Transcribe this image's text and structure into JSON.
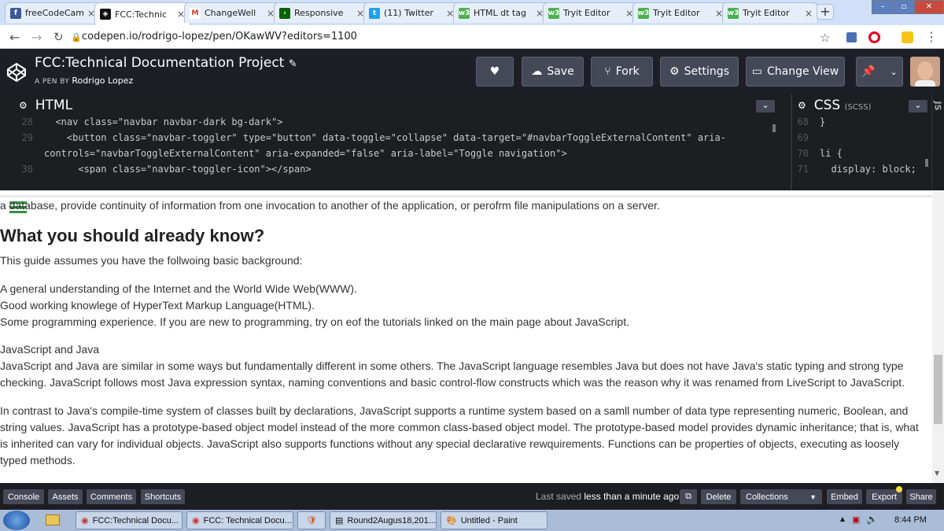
{
  "browser": {
    "tabs": [
      {
        "label": "freeCodeCam",
        "icon": "facebook-icon",
        "color": "#3b5998",
        "glyph": "f"
      },
      {
        "label": "FCC:Technic",
        "icon": "codepen-icon",
        "color": "#111111",
        "glyph": "◈"
      },
      {
        "label": "ChangeWell",
        "icon": "gmail-icon",
        "color": "#ffffff",
        "glyph": "M"
      },
      {
        "label": "Responsive",
        "icon": "freecodecamp-icon",
        "color": "#006400",
        "glyph": "›"
      },
      {
        "label": "(11) Twitter",
        "icon": "twitter-icon",
        "color": "#1da1f2",
        "glyph": "t"
      },
      {
        "label": "HTML dt tag",
        "icon": "w3schools-icon",
        "color": "#4caf50",
        "glyph": "w3"
      },
      {
        "label": "Tryit Editor",
        "icon": "w3schools-icon",
        "color": "#4caf50",
        "glyph": "w3"
      },
      {
        "label": "Tryit Editor",
        "icon": "w3schools-icon",
        "color": "#4caf50",
        "glyph": "w3"
      },
      {
        "label": "Tryit Editor",
        "icon": "w3schools-icon",
        "color": "#4caf50",
        "glyph": "w3"
      }
    ],
    "url": "codepen.io/rodrigo-lopez/pen/OKawWV?editors=1100"
  },
  "pen": {
    "title": "FCC:Technical Documentation Project",
    "author_prefix": "A PEN BY",
    "author": "Rodrigo Lopez",
    "buttons": {
      "save": "Save",
      "fork": "Fork",
      "settings": "Settings",
      "change_view": "Change View"
    }
  },
  "html_panel": {
    "title": "HTML",
    "lines": [
      {
        "n": "28",
        "code": "  <nav class=\"navbar navbar-dark bg-dark\">"
      },
      {
        "n": "29",
        "code": "    <button class=\"navbar-toggler\" type=\"button\" data-toggle=\"collapse\" data-target=\"#navbarToggleExternalContent\" aria-"
      },
      {
        "n": "",
        "code": "controls=\"navbarToggleExternalContent\" aria-expanded=\"false\" aria-label=\"Toggle navigation\">"
      },
      {
        "n": "30",
        "code": "      <span class=\"navbar-toggler-icon\"></span>"
      }
    ]
  },
  "css_panel": {
    "title": "CSS",
    "sub": "(SCSS)",
    "lines": [
      {
        "n": "68",
        "code": "}"
      },
      {
        "n": "69",
        "code": ""
      },
      {
        "n": "70",
        "code": "li {"
      },
      {
        "n": "71",
        "code": "  display: block;"
      }
    ]
  },
  "js_tab": "JS",
  "content": {
    "intro": "a database, provide continuity of information from one invocation to another of the application, or perofrm file manipulations on a server.",
    "heading": "What you should already know?",
    "p1": "This guide assumes you have the follwoing basic background:",
    "list": [
      "A general understanding of the Internet and the World Wide Web(WWW).",
      "Good working knowlege of HyperText Markup Language(HTML).",
      "Some programming experience. If you are new to programming, try on eof the tutorials linked on the main page about JavaScript."
    ],
    "subtitle": "JavaScript and Java",
    "p2": "JavaScript and Java are similar in some ways but fundamentally different in some others. The JavaScript language resembles Java but does not have Java's static typing and strong type checking. JavaScript follows most Java expression syntax, naming conventions and basic control-flow constructs which was the reason why it was renamed from LiveScript to JavaScript.",
    "p3": "In contrast to Java's compile-time system of classes built by declarations, JavaScript supports a runtime system based on a samll number of data type representing numeric, Boolean, and string values. JavaScript has a prototype-based object model instead of the more common class-based object model. The prototype-based model provides dynamic inheritance; that is, what is inherited can vary for individual objects. JavaScript also supports functions without any special declarative rewquirements. Functions can be properties of objects, executing as loosely typed methods."
  },
  "bottom_bar": {
    "console": "Console",
    "assets": "Assets",
    "comments": "Comments",
    "shortcuts": "Shortcuts",
    "saved": "Last saved",
    "saved_time": "less than a minute ago",
    "delete": "Delete",
    "collections": "Collections",
    "embed": "Embed",
    "export": "Export",
    "share": "Share"
  },
  "taskbar": {
    "items": [
      "FCC:Technical Docu...",
      "FCC: Technical Docu...",
      "",
      "Round2Augus18,201...",
      "Untitled - Paint"
    ],
    "time": "8:44 PM"
  },
  "colors": {
    "accent_green": "#47cf73",
    "codepen_dark": "#1e1f26"
  }
}
